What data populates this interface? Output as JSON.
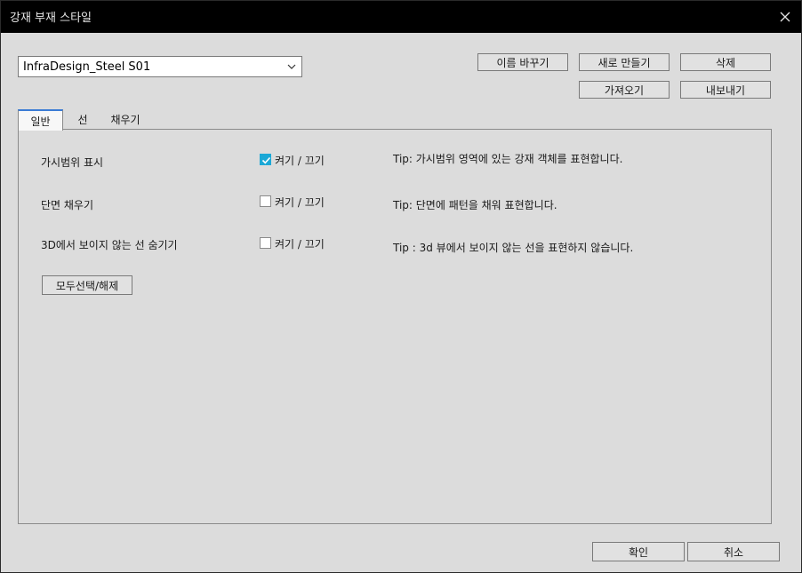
{
  "window": {
    "title": "강재 부재 스타일"
  },
  "style_select": {
    "value": "InfraDesign_Steel S01"
  },
  "buttons": {
    "rename": "이름 바꾸기",
    "new": "새로 만들기",
    "delete": "삭제",
    "import": "가져오기",
    "export": "내보내기",
    "select_all": "모두선택/해제",
    "ok": "확인",
    "cancel": "취소"
  },
  "tabs": [
    {
      "label": "일반",
      "active": true
    },
    {
      "label": "선",
      "active": false
    },
    {
      "label": "채우기",
      "active": false
    }
  ],
  "options": [
    {
      "label": "가시범위 표시",
      "toggle_label": "켜기 / 끄기",
      "checked": true,
      "tip": "Tip: 가시범위 영역에 있는 강재 객체를 표현합니다."
    },
    {
      "label": "단면 채우기",
      "toggle_label": "켜기 / 끄기",
      "checked": false,
      "tip": "Tip: 단면에 패턴을 채워 표현합니다."
    },
    {
      "label": "3D에서 보이지 않는 선 숨기기",
      "toggle_label": "켜기 / 끄기",
      "checked": false,
      "tip": "Tip : 3d 뷰에서 보이지 않는 선을 표현하지 않습니다."
    }
  ],
  "colors": {
    "titlebar": "#000000",
    "check_accent": "#1ba8d6",
    "tab_accent": "#3a7bd5"
  },
  "icons": {
    "close": "close-icon",
    "dropdown": "chevron-down-icon",
    "check": "check-icon"
  }
}
